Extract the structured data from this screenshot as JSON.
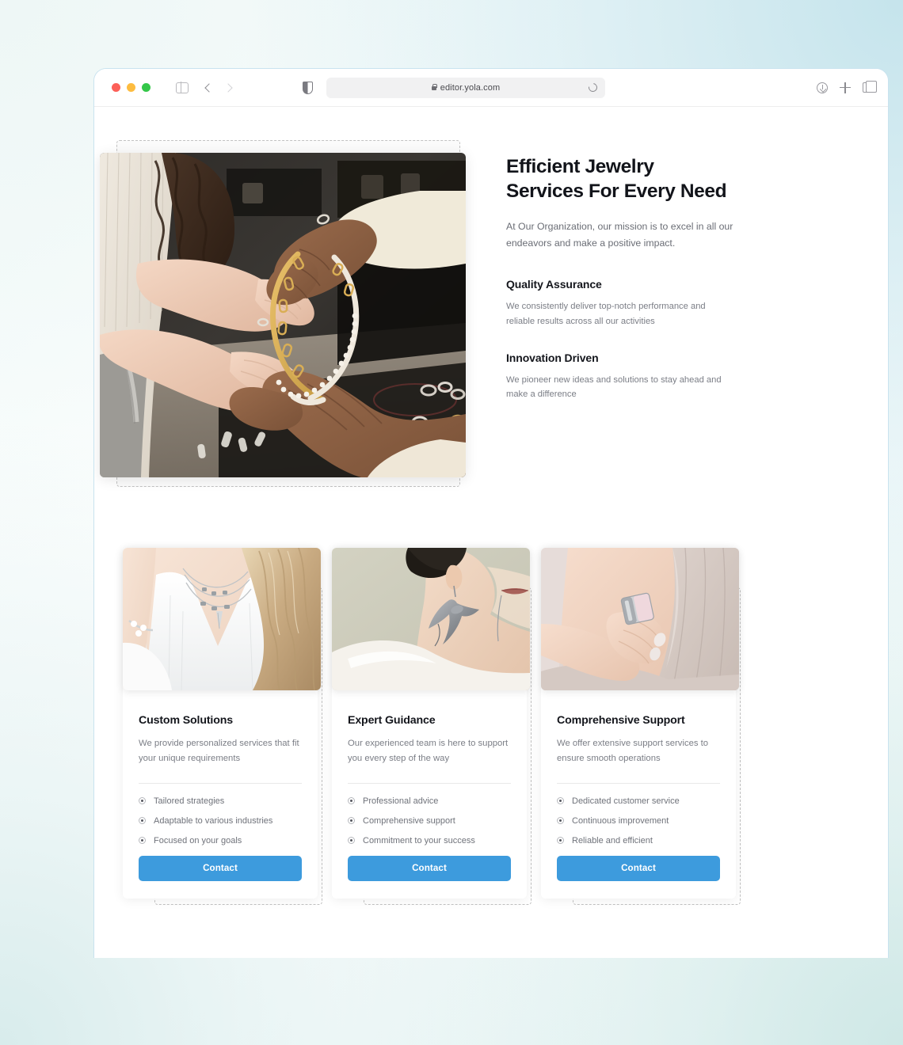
{
  "browser": {
    "url": "editor.yola.com",
    "traffic_lights": [
      "close",
      "minimize",
      "maximize"
    ],
    "icons": {
      "sidebar": "sidebar-toggle-icon",
      "back": "chevron-left-icon",
      "forward": "chevron-right-icon",
      "shield": "privacy-shield-icon",
      "lock": "lock-icon",
      "reload": "reload-icon",
      "download": "downloads-icon",
      "new_tab": "plus-icon",
      "tab_overview": "tab-overview-icon"
    }
  },
  "hero": {
    "title_line1": "Efficient Jewelry",
    "title_line2": "Services For Every Need",
    "subtitle": "At Our Organization, our mission is to excel in all our endeavors and make a positive impact.",
    "image_alt": "hands exchanging a gold chain and pearl necklace in a jewelry store",
    "features": [
      {
        "title": "Quality Assurance",
        "desc": "We consistently deliver top-notch performance and reliable results across all our activities"
      },
      {
        "title": "Innovation Driven",
        "desc": "We pioneer new ideas and solutions to stay ahead and make a difference"
      }
    ]
  },
  "cards": [
    {
      "title": "Custom Solutions",
      "desc": "We provide personalized services that fit your unique requirements",
      "image_alt": "blonde woman wearing layered silver necklaces",
      "items": [
        "Tailored strategies",
        "Adaptable to various industries",
        "Focused on your goals"
      ],
      "button": "Contact"
    },
    {
      "title": "Expert Guidance",
      "desc": "Our experienced team is here to support you every step of the way",
      "image_alt": "profile of woman wearing a large sculptural silver earring",
      "items": [
        "Professional advice",
        "Comprehensive support",
        "Commitment to your success"
      ],
      "button": "Contact"
    },
    {
      "title": "Comprehensive Support",
      "desc": "We offer extensive support services to ensure smooth operations",
      "image_alt": "hand wearing a large square ring against draped fabric",
      "items": [
        "Dedicated customer service",
        "Continuous improvement",
        "Reliable and efficient"
      ],
      "button": "Contact"
    }
  ],
  "colors": {
    "accent_blue": "#3d9bdd",
    "heading": "#14161c",
    "body_text": "#7b7e86",
    "page_background_top_right": "#c5e4ec",
    "page_background_bottom": "#eaf6f6",
    "browser_border": "#c9e3ef",
    "selection_dash": "#c2c2c2"
  }
}
